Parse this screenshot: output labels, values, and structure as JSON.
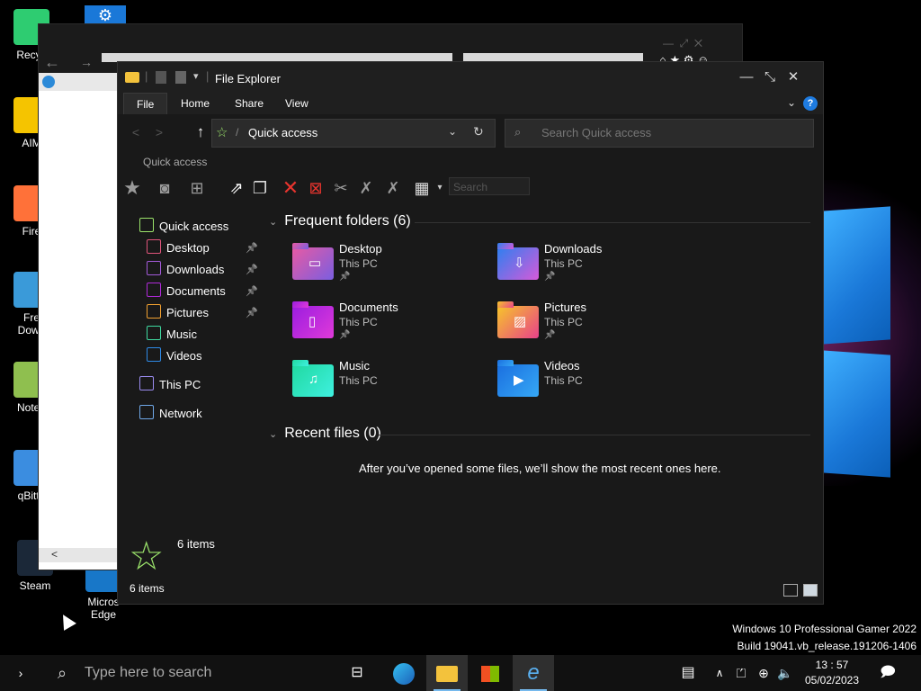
{
  "colors": {
    "accent": "#1e7be0",
    "taskbar": "#111111",
    "explorer_bg": "#191919",
    "active_indicator": "#76b9ed"
  },
  "desktop_icons": [
    {
      "label": "Recyc",
      "icon": "recycle-bin-icon",
      "color": "#2ecc71"
    },
    {
      "label": "AIM",
      "icon": "aim-icon",
      "color": "#f5c400"
    },
    {
      "label": "Fire",
      "icon": "firefox-icon",
      "color": "#ff7139"
    },
    {
      "label": "Fre\nDown",
      "icon": "free-download-manager-icon",
      "color": "#3a9ad9"
    },
    {
      "label": "Notep",
      "icon": "notepad-icon",
      "color": "#8fbf4f"
    },
    {
      "label": "qBitto",
      "icon": "qbittorrent-icon",
      "color": "#3b8de0"
    },
    {
      "label": "Steam",
      "icon": "steam-icon",
      "color": "#1b2838"
    },
    {
      "label": "Micros\nEdge",
      "icon": "edge-icon",
      "color": "#1877c8"
    }
  ],
  "explorer": {
    "title": "File Explorer",
    "tabs": [
      "File",
      "Home",
      "Share",
      "View"
    ],
    "address": "Quick access",
    "search_placeholder": "Search Quick access",
    "toolbar_label": "Quick access",
    "toolbar_search_placeholder": "Search",
    "nav": [
      {
        "label": "Quick access",
        "icon": "star-icon",
        "color": "#9be36b",
        "pinned": false
      },
      {
        "label": "Desktop",
        "icon": "desktop-icon",
        "color": "#e0557b",
        "pinned": true
      },
      {
        "label": "Downloads",
        "icon": "download-icon",
        "color": "#a35ad9",
        "pinned": true
      },
      {
        "label": "Documents",
        "icon": "document-icon",
        "color": "#b02ad9",
        "pinned": true
      },
      {
        "label": "Pictures",
        "icon": "picture-icon",
        "color": "#f0a030",
        "pinned": true
      },
      {
        "label": "Music",
        "icon": "music-icon",
        "color": "#3fd9a0",
        "pinned": false
      },
      {
        "label": "Videos",
        "icon": "video-icon",
        "color": "#2e8ae6",
        "pinned": false
      },
      {
        "label": "This PC",
        "icon": "computer-icon",
        "color": "#9b8cf0",
        "pinned": false
      },
      {
        "label": "Network",
        "icon": "network-icon",
        "color": "#6fa8e8",
        "pinned": false
      }
    ],
    "frequent_header": "Frequent folders (6)",
    "recent_header": "Recent files (0)",
    "folders": [
      {
        "name": "Desktop",
        "location": "This PC",
        "pinned": true,
        "icon": "desktop-folder-icon",
        "from": "#e85aa3",
        "to": "#7a5ee0"
      },
      {
        "name": "Downloads",
        "location": "This PC",
        "pinned": true,
        "icon": "downloads-folder-icon",
        "from": "#2e7ff0",
        "to": "#d65ad9"
      },
      {
        "name": "Documents",
        "location": "This PC",
        "pinned": true,
        "icon": "documents-folder-icon",
        "from": "#9b1de0",
        "to": "#e03ad9"
      },
      {
        "name": "Pictures",
        "location": "This PC",
        "pinned": true,
        "icon": "pictures-folder-icon",
        "from": "#f7c52a",
        "to": "#e8418a"
      },
      {
        "name": "Music",
        "location": "This PC",
        "pinned": false,
        "icon": "music-folder-icon",
        "from": "#20d9a0",
        "to": "#3ff0e0"
      },
      {
        "name": "Videos",
        "location": "This PC",
        "pinned": false,
        "icon": "videos-folder-icon",
        "from": "#1a6fe0",
        "to": "#36a8f5"
      }
    ],
    "empty_message": "After you’ve opened some files, we’ll show the most recent ones here.",
    "details_count": "6 items",
    "status_count": "6 items"
  },
  "watermark": {
    "line1": "Windows 10 Professional Gamer 2022",
    "line2": "Build 19041.vb_release.191206-1406"
  },
  "taskbar": {
    "search_placeholder": "Type here to search",
    "time": "13 : 57",
    "date": "05/02/2023"
  }
}
